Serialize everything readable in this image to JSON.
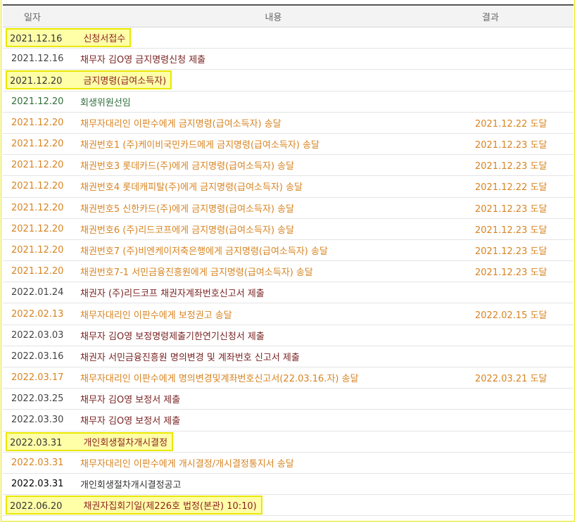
{
  "header": {
    "date": "일자",
    "content": "내용",
    "result": "결과"
  },
  "rows": [
    {
      "date": "2021.12.16",
      "content": "신청서접수",
      "result": "",
      "style": "hl"
    },
    {
      "date": "2021.12.16",
      "content": "채무자 김O영 금지명령신청 제출",
      "result": "",
      "style": "dark"
    },
    {
      "date": "2021.12.20",
      "content": "금지명령(급여소득자)",
      "result": "",
      "style": "hl"
    },
    {
      "date": "2021.12.20",
      "content": "회생위원선임",
      "result": "",
      "style": "green"
    },
    {
      "date": "2021.12.20",
      "content": "채무자대리인 이판수에게 금지명령(급여소득자) 송달",
      "result": "2021.12.22 도달",
      "style": "orange"
    },
    {
      "date": "2021.12.20",
      "content": "채권번호1 (주)케이비국민카드에게 금지명령(급여소득자) 송달",
      "result": "2021.12.23 도달",
      "style": "orange"
    },
    {
      "date": "2021.12.20",
      "content": "채권번호3 롯데카드(주)에게 금지명령(급여소득자) 송달",
      "result": "2021.12.23 도달",
      "style": "orange"
    },
    {
      "date": "2021.12.20",
      "content": "채권번호4 롯데캐피탈(주)에게 금지명령(급여소득자) 송달",
      "result": "2021.12.22 도달",
      "style": "orange"
    },
    {
      "date": "2021.12.20",
      "content": "채권번호5 신한카드(주)에게 금지명령(급여소득자) 송달",
      "result": "2021.12.23 도달",
      "style": "orange"
    },
    {
      "date": "2021.12.20",
      "content": "채권번호6 (주)리드코프에게 금지명령(급여소득자) 송달",
      "result": "2021.12.23 도달",
      "style": "orange"
    },
    {
      "date": "2021.12.20",
      "content": "채권번호7 (주)비엔케이저축은행에게 금지명령(급여소득자) 송달",
      "result": "2021.12.23 도달",
      "style": "orange"
    },
    {
      "date": "2021.12.20",
      "content": "채권번호7-1 서민금융진흥원에게 금지명령(급여소득자) 송달",
      "result": "2021.12.23 도달",
      "style": "orange"
    },
    {
      "date": "2022.01.24",
      "content": "채권자 (주)리드코프 채권자계좌번호신고서 제출",
      "result": "",
      "style": "dark"
    },
    {
      "date": "2022.02.13",
      "content": "채무자대리인 이판수에게 보정권고 송달",
      "result": "2022.02.15 도달",
      "style": "orange"
    },
    {
      "date": "2022.03.03",
      "content": "채무자 김O영 보정명령제출기한연기신청서 제출",
      "result": "",
      "style": "dark"
    },
    {
      "date": "2022.03.16",
      "content": "채권자 서민금융진흥원 명의변경 및 계좌번호 신고서 제출",
      "result": "",
      "style": "dark"
    },
    {
      "date": "2022.03.17",
      "content": "채무자대리인 이판수에게 명의변경및계좌번호신고서(22.03.16.자) 송달",
      "result": "2022.03.21 도달",
      "style": "orange"
    },
    {
      "date": "2022.03.25",
      "content": "채무자 김O영 보정서 제출",
      "result": "",
      "style": "dark"
    },
    {
      "date": "2022.03.30",
      "content": "채무자 김O영 보정서 제출",
      "result": "",
      "style": "dark"
    },
    {
      "date": "2022.03.31",
      "content": "개인회생절차개시결정",
      "result": "",
      "style": "hl"
    },
    {
      "date": "2022.03.31",
      "content": "채무자대리인 이판수에게 개시결정/개시결정통지서 송달",
      "result": "",
      "style": "orange"
    },
    {
      "date": "2022.03.31",
      "content": "개인회생절차개시결정공고",
      "result": "",
      "style": "plain"
    },
    {
      "date": "2022.06.20",
      "content": "채권자집회기일(제226호 법정(본관) 10:10)",
      "result": "",
      "style": "hl"
    }
  ]
}
